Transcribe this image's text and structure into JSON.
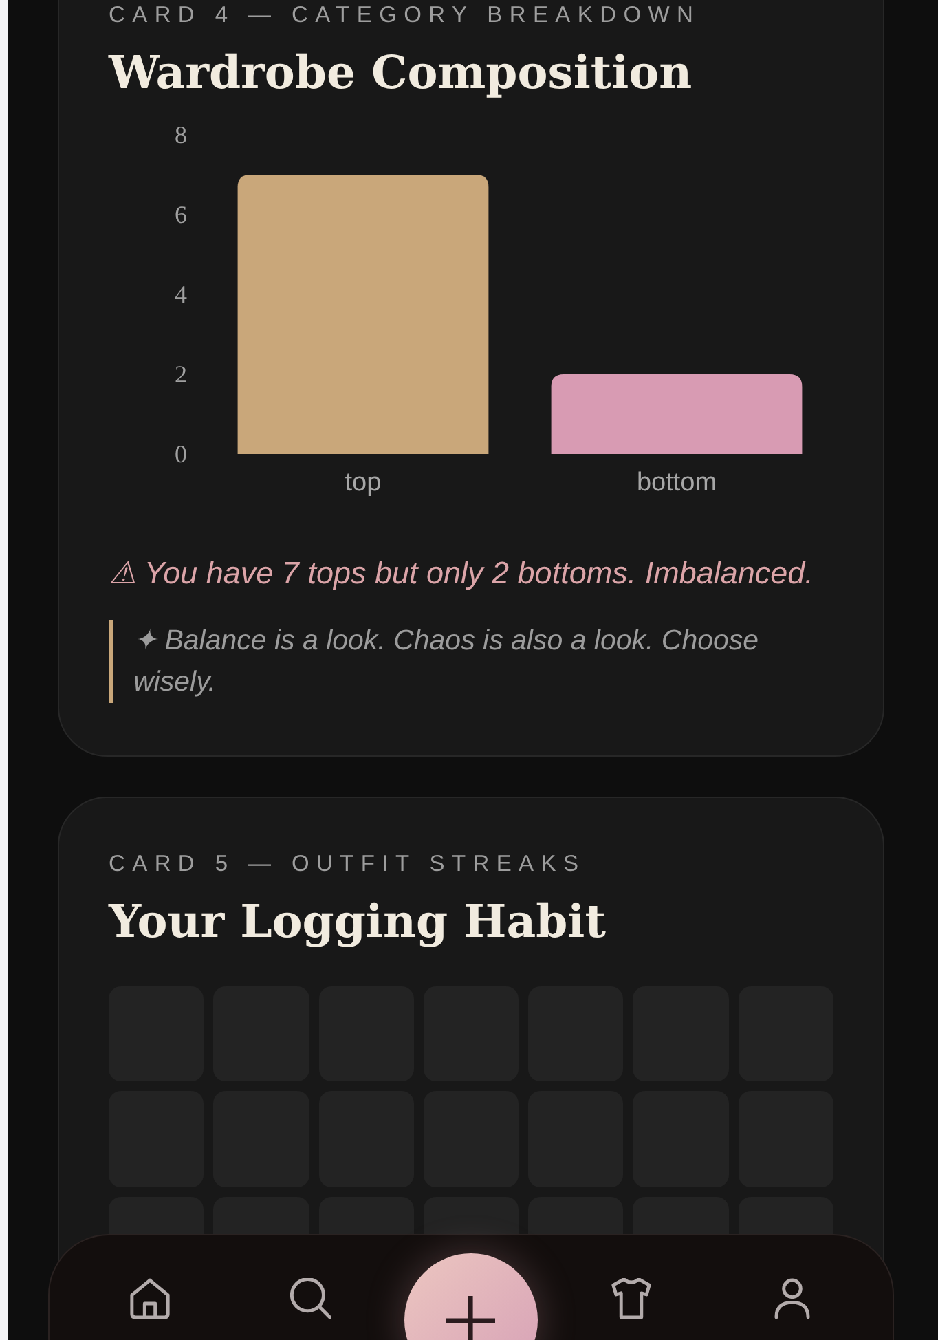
{
  "cards": [
    {
      "kind": "chart",
      "kicker": "CARD 4 — CATEGORY BREAKDOWN",
      "title": "Wardrobe Composition",
      "chart_data": {
        "type": "bar",
        "categories": [
          "top",
          "bottom"
        ],
        "values": [
          7,
          2
        ],
        "colors": [
          "#c9a77a",
          "#d89bb3"
        ],
        "ylim": [
          0,
          8
        ],
        "yticks": [
          0,
          2,
          4,
          6,
          8
        ]
      },
      "warning": "⚠ You have 7 tops but only 2 bottoms. Imbalanced.",
      "note": "✦ Balance is a look. Chaos is also a look. Choose wisely."
    },
    {
      "kind": "streaks",
      "kicker": "CARD 5 — OUTFIT STREAKS",
      "title": "Your Logging Habit",
      "days": [
        {
          "logged": false
        },
        {
          "logged": false
        },
        {
          "logged": false
        },
        {
          "logged": false
        },
        {
          "logged": false
        },
        {
          "logged": false
        },
        {
          "logged": false
        },
        {
          "logged": false
        },
        {
          "logged": false
        },
        {
          "logged": false
        },
        {
          "logged": false
        },
        {
          "logged": false
        },
        {
          "logged": false
        },
        {
          "logged": false
        },
        {
          "logged": false
        },
        {
          "logged": false
        },
        {
          "logged": false
        },
        {
          "logged": false
        },
        {
          "logged": false
        },
        {
          "logged": false
        },
        {
          "logged": false
        }
      ]
    }
  ],
  "nav": {
    "items": [
      {
        "kind": "tab",
        "selected": false
      },
      {
        "kind": "tab",
        "selected": false
      },
      {
        "kind": "action"
      },
      {
        "kind": "tab",
        "selected": false
      },
      {
        "kind": "tab",
        "selected": false
      }
    ]
  }
}
